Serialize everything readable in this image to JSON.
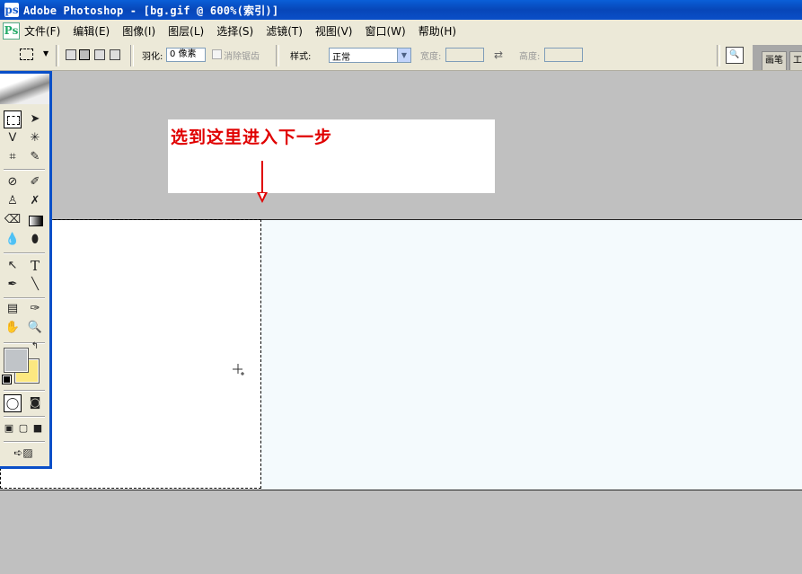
{
  "window": {
    "title": "Adobe Photoshop - [bg.gif @ 600%(索引)]"
  },
  "menu": {
    "items": [
      "文件(F)",
      "编辑(E)",
      "图像(I)",
      "图层(L)",
      "选择(S)",
      "滤镜(T)",
      "视图(V)",
      "窗口(W)",
      "帮助(H)"
    ]
  },
  "options": {
    "feather_label": "羽化:",
    "feather_value": "0 像素",
    "antialias_label": "消除锯齿",
    "style_label": "样式:",
    "style_value": "正常",
    "width_label": "宽度:",
    "height_label": "高度:",
    "tabs": [
      "画笔",
      "工"
    ]
  },
  "annotation": {
    "text": "选到这里进入下一步",
    "color": "#e00000"
  },
  "colors": {
    "foreground": "#c0c4c8",
    "background": "#fce880",
    "titlebar": "#0a4fc8"
  },
  "toolbox": {
    "tools": [
      "rectangular-marquee-icon",
      "move-icon",
      "lasso-icon",
      "magic-wand-icon",
      "crop-icon",
      "slice-icon",
      "healing-brush-icon",
      "brush-icon",
      "clone-stamp-icon",
      "history-brush-icon",
      "eraser-icon",
      "gradient-icon",
      "blur-icon",
      "dodge-icon",
      "path-selection-icon",
      "type-icon",
      "pen-icon",
      "line-icon",
      "notes-icon",
      "eyedropper-icon",
      "hand-icon",
      "zoom-icon"
    ]
  }
}
